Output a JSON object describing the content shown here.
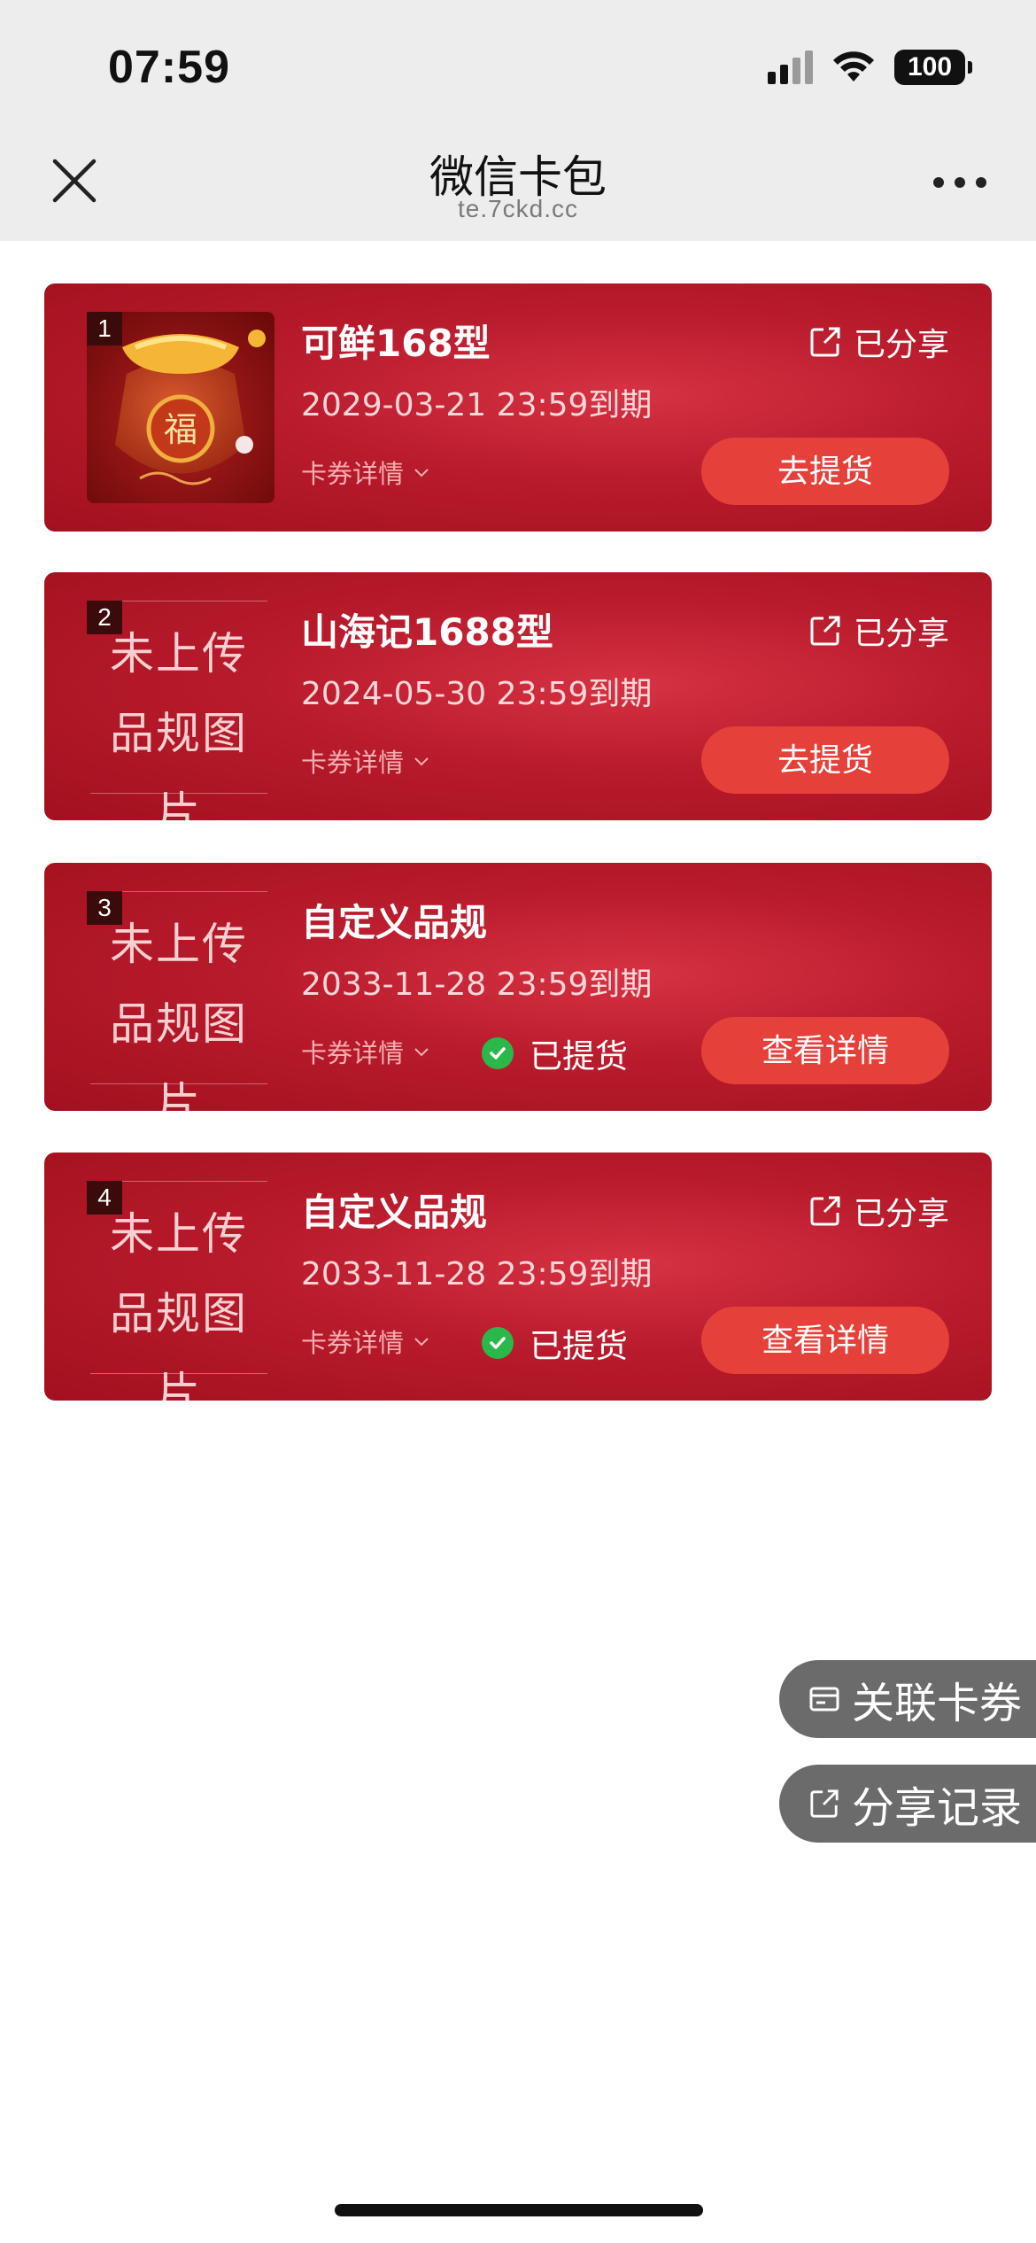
{
  "status_bar": {
    "time": "07:59",
    "battery": "100"
  },
  "header": {
    "title": "微信卡包",
    "url": "te.7ckd.cc"
  },
  "cards": [
    {
      "index": "1",
      "title": "可鲜168型",
      "date": "2029-03-21 23:59到期",
      "detail": "卡券详情",
      "shared": "已分享",
      "picked": "",
      "action": "去提货",
      "has_image": true
    },
    {
      "index": "2",
      "title": "山海记1688型",
      "date": "2024-05-30 23:59到期",
      "detail": "卡券详情",
      "shared": "已分享",
      "picked": "",
      "action": "去提货",
      "placeholder": [
        "未上传",
        "品规图片"
      ]
    },
    {
      "index": "3",
      "title": "自定义品规",
      "date": "2033-11-28 23:59到期",
      "detail": "卡券详情",
      "shared": "",
      "picked": "已提货",
      "action": "查看详情",
      "placeholder": [
        "未上传",
        "品规图片"
      ]
    },
    {
      "index": "4",
      "title": "自定义品规",
      "date": "2033-11-28 23:59到期",
      "detail": "卡券详情",
      "shared": "已分享",
      "picked": "已提货",
      "action": "查看详情",
      "placeholder": [
        "未上传",
        "品规图片"
      ]
    }
  ],
  "floating": {
    "link_cards": "关联卡券",
    "share_records": "分享记录"
  },
  "colors": {
    "card_red": "#b81b2c",
    "button_red": "#e5413a",
    "check_green": "#2bb84a",
    "pill_gray": "#6b6b6b"
  }
}
